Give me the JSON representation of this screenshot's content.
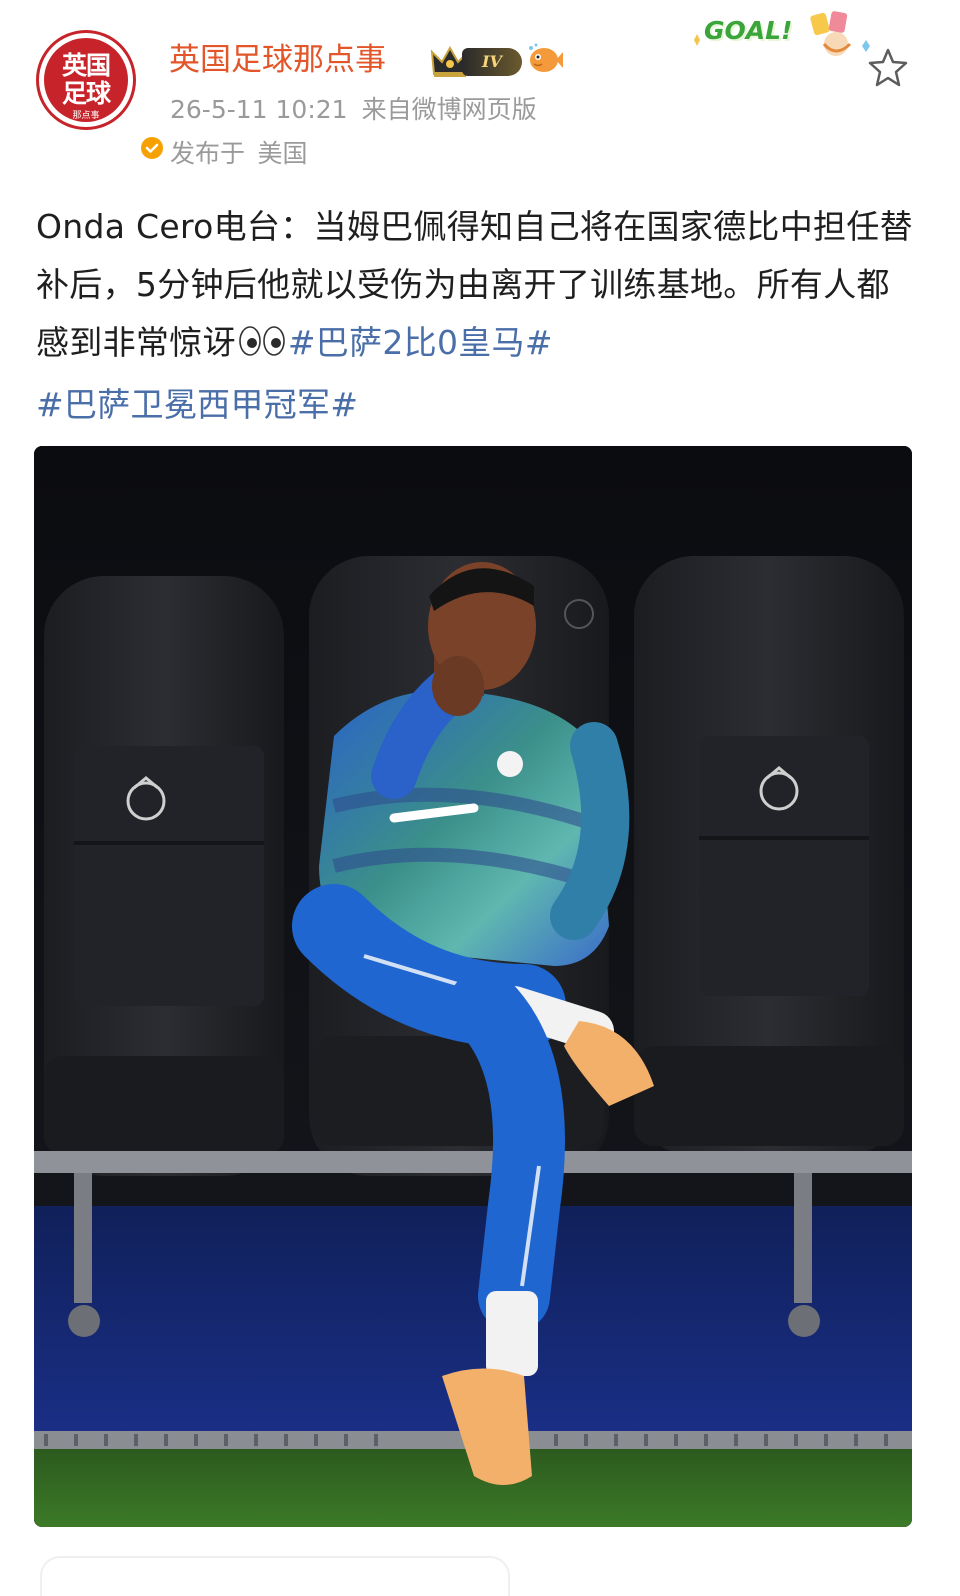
{
  "author": {
    "name": "英国足球那点事",
    "avatar_text": "英国足球",
    "avatar_sub": "那点事",
    "level_badge": "IV",
    "icons": [
      "crown-icon",
      "verified-icon",
      "fish-icon",
      "star-icon"
    ]
  },
  "post_meta": {
    "timestamp": "26-5-11 10:21",
    "source": "来自微博网页版",
    "location_label": "发布于",
    "location": "美国"
  },
  "sticker": {
    "text": "GOAL!"
  },
  "post": {
    "text_main": "Onda Cero电台：当姆巴佩得知自己将在国家德比中担任替补后，5分钟后他就以受伤为由离开了训练基地。所有人都感到非常惊讶",
    "topics": [
      "#巴萨2比0皇马#",
      "#巴萨卫冕西甲冠军#"
    ]
  },
  "colors": {
    "username": "#e3562a",
    "topic": "#4a6ea8",
    "meta": "#9a9a9a",
    "body_text": "#1f1f1f",
    "jersey": "#1f66d1",
    "pitch": "#2e5b1e"
  }
}
